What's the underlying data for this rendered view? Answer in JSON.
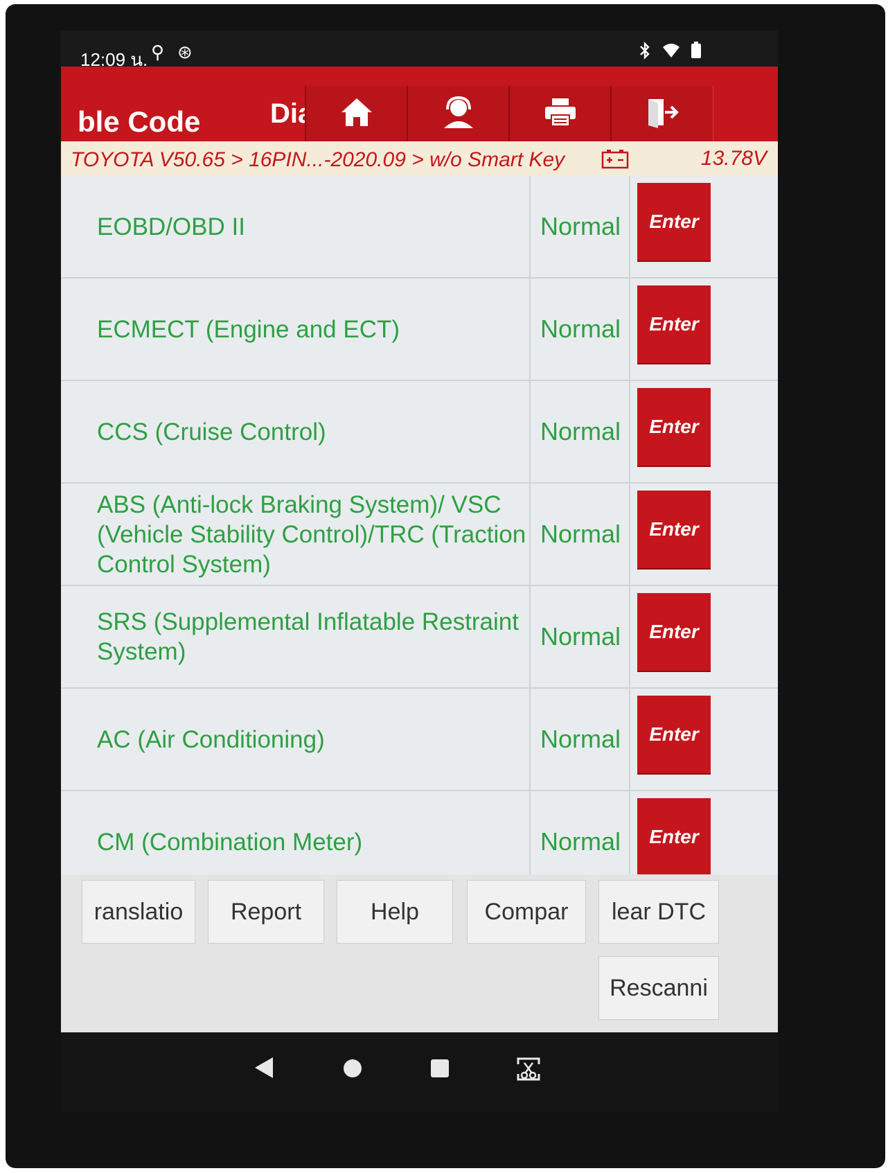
{
  "status_bar": {
    "time": "12:09 น.",
    "icons": [
      "usb-debug-icon",
      "accessibility-icon",
      "bluetooth-icon",
      "wifi-icon",
      "battery-icon"
    ]
  },
  "header": {
    "title": "ble Code",
    "tab": "Dia",
    "buttons": [
      "home-icon",
      "support-icon",
      "print-icon",
      "exit-icon"
    ]
  },
  "breadcrumb": {
    "path": "TOYOTA V50.65 > 16PIN...-2020.09 > w/o Smart Key",
    "voltage": "13.78V"
  },
  "systems": [
    {
      "name": "EOBD/OBD II",
      "status": "Normal",
      "action": "Enter"
    },
    {
      "name": "ECMECT (Engine and ECT)",
      "status": "Normal",
      "action": "Enter"
    },
    {
      "name": "CCS (Cruise Control)",
      "status": "Normal",
      "action": "Enter"
    },
    {
      "name": "ABS (Anti-lock Braking System)/ VSC (Vehicle Stability Control)/TRC (Traction Control System)",
      "status": "Normal",
      "action": "Enter"
    },
    {
      "name": "SRS (Supplemental Inflatable Restraint System)",
      "status": "Normal",
      "action": "Enter"
    },
    {
      "name": "AC (Air Conditioning)",
      "status": "Normal",
      "action": "Enter"
    },
    {
      "name": "CM (Combination Meter)",
      "status": "Normal",
      "action": "Enter"
    }
  ],
  "toolbar": {
    "translation": "ranslatio",
    "report": "Report",
    "help": "Help",
    "compare": "Compar",
    "clear_dtc": "lear DTC",
    "rescanning": "Rescanni"
  },
  "colors": {
    "brand_red": "#c4161c",
    "status_green": "#2ea043",
    "breadcrumb_bg": "#f4ecd8"
  }
}
